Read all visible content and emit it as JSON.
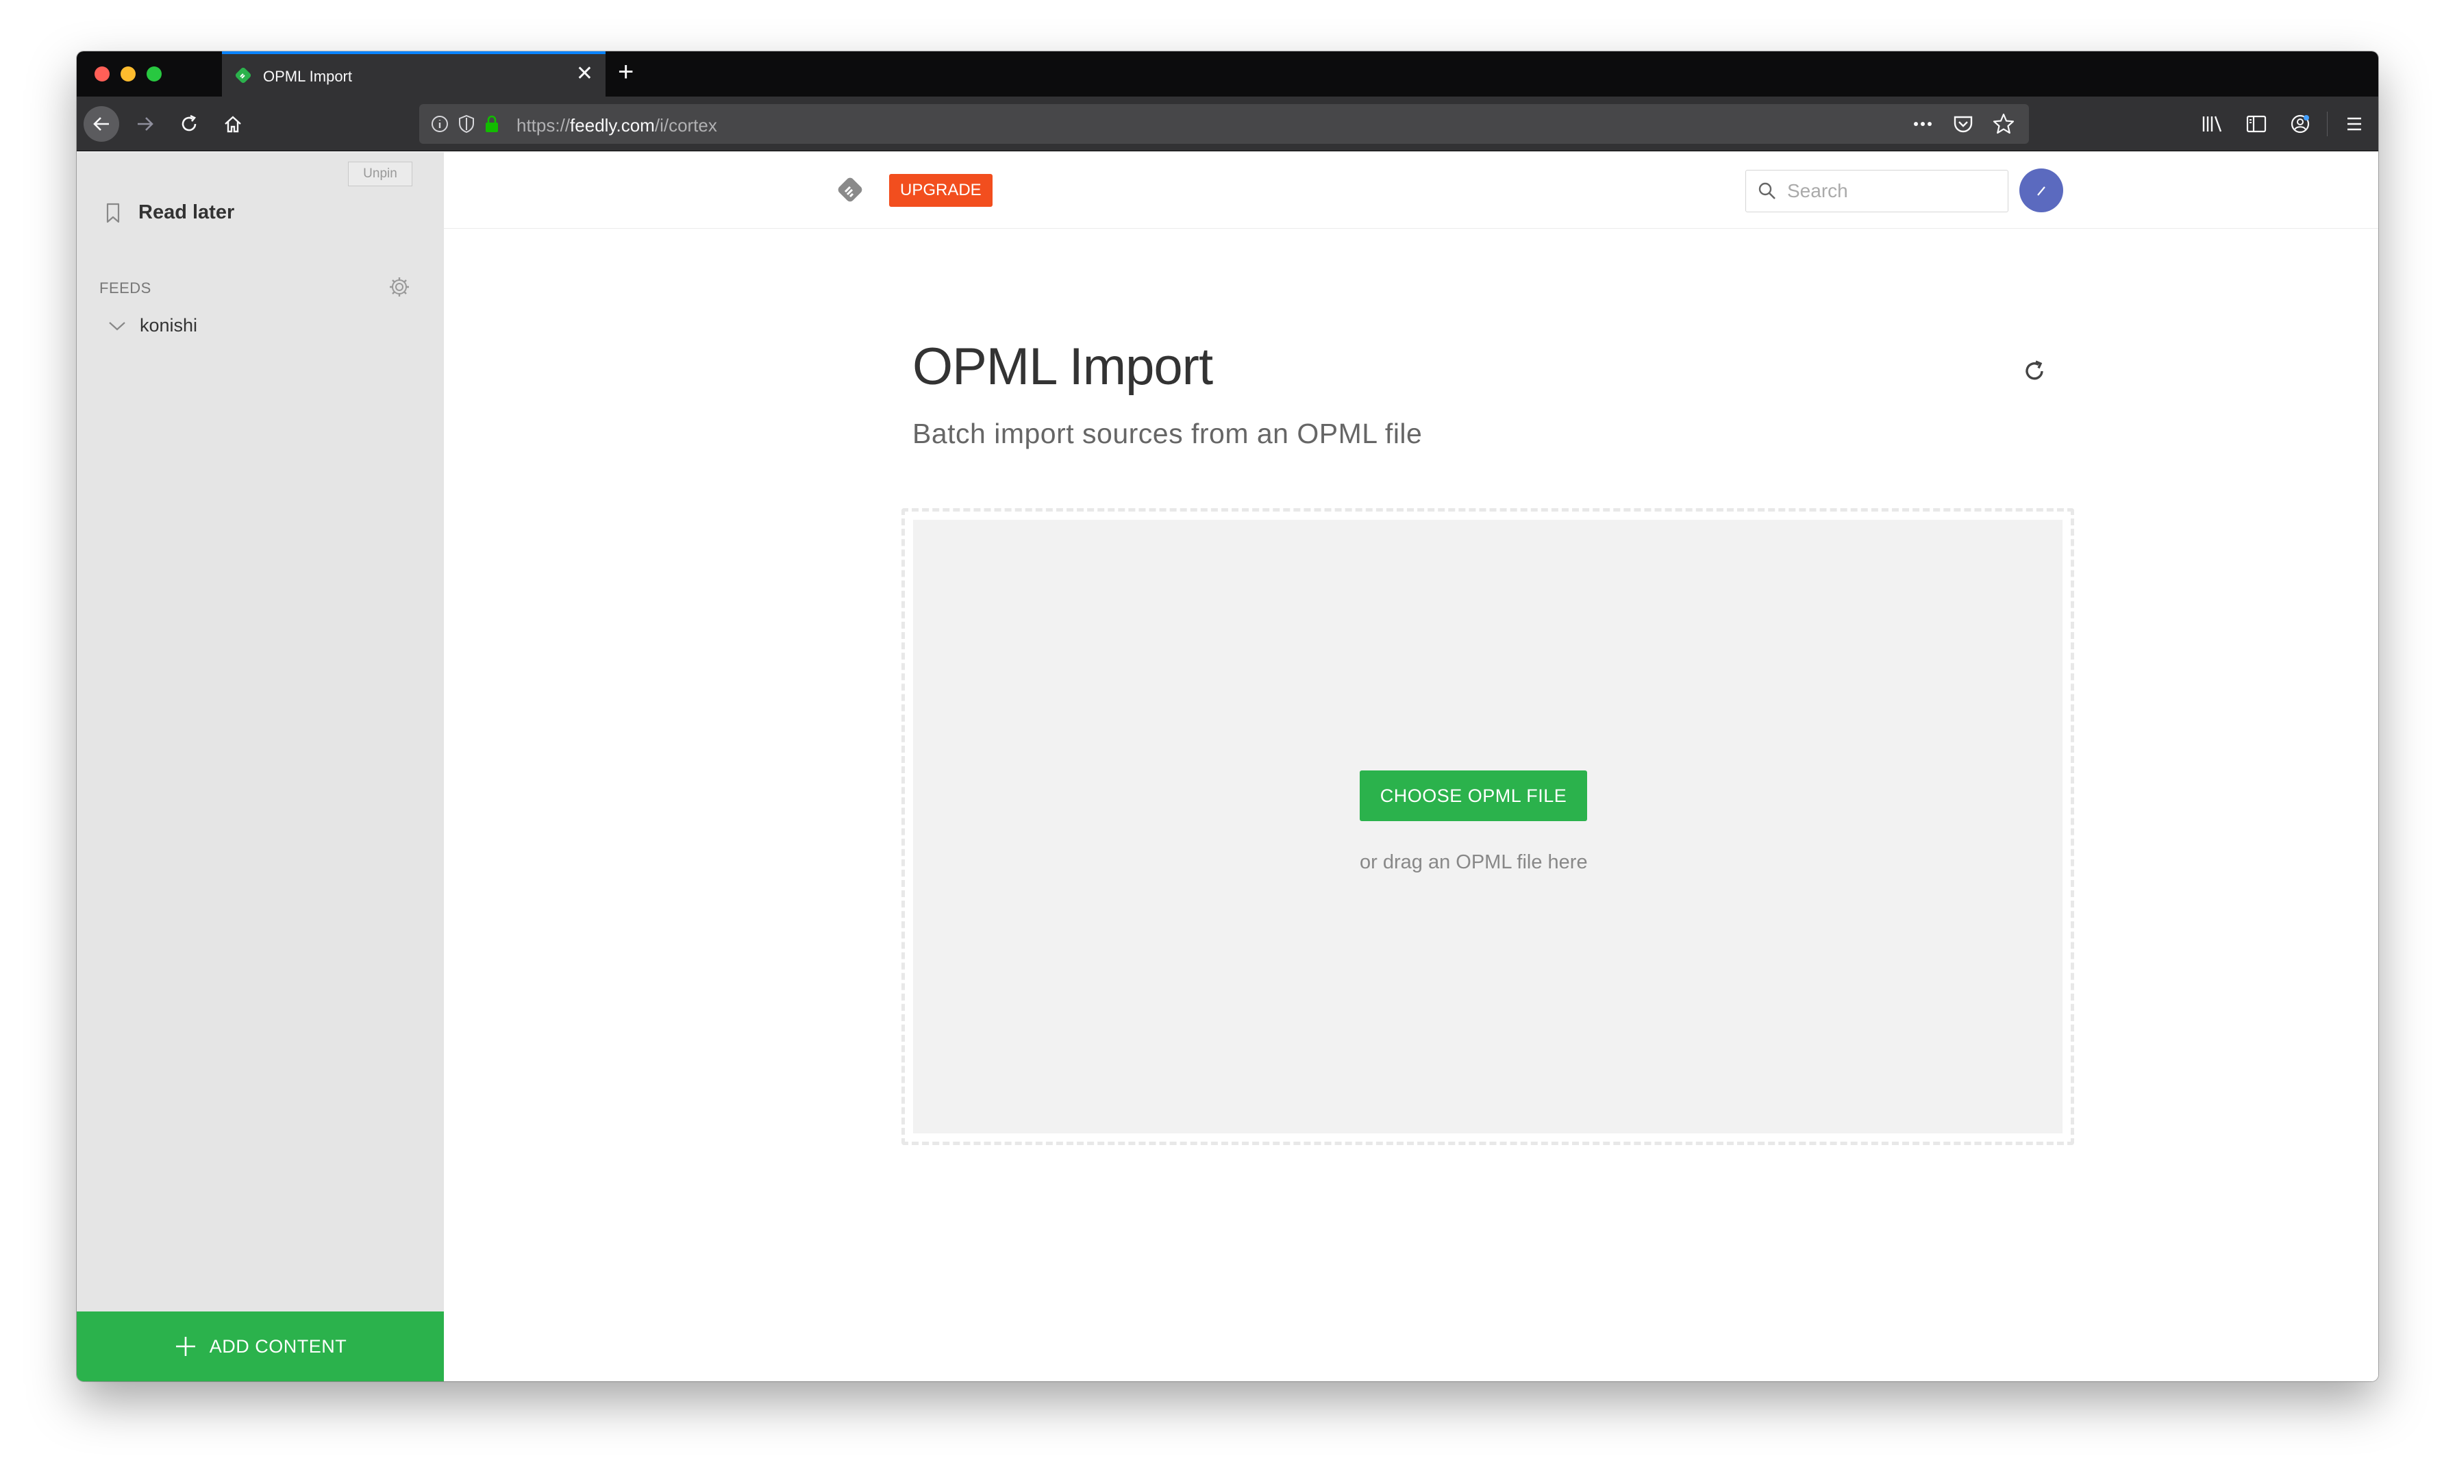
{
  "browser": {
    "tab_title": "OPML Import",
    "url_scheme": "https://",
    "url_host": "feedly.com",
    "url_path": "/i/cortex"
  },
  "sidebar": {
    "unpin_label": "Unpin",
    "read_later_label": "Read later",
    "feeds_header": "FEEDS",
    "feeds": [
      {
        "label": "konishi"
      }
    ],
    "add_content_label": "ADD CONTENT"
  },
  "header": {
    "upgrade_label": "UPGRADE",
    "search_placeholder": "Search"
  },
  "main": {
    "title": "OPML Import",
    "subtitle": "Batch import sources from an OPML file",
    "choose_button_label": "CHOOSE OPML FILE",
    "drag_hint": "or drag an OPML file here"
  },
  "colors": {
    "accent_green": "#2bb24c",
    "upgrade_orange": "#f24e1e",
    "avatar_blue": "#5b6abf",
    "tab_highlight": "#0a84ff"
  },
  "icons": {
    "tab_favicon": "feedly-icon",
    "back": "back-arrow-icon",
    "forward": "forward-arrow-icon",
    "reload": "reload-icon",
    "home": "home-icon",
    "bookmark": "bookmark-icon",
    "gear": "gear-icon",
    "chevron": "chevron-down-icon",
    "plus": "plus-icon",
    "search": "search-icon",
    "refresh": "refresh-icon"
  }
}
